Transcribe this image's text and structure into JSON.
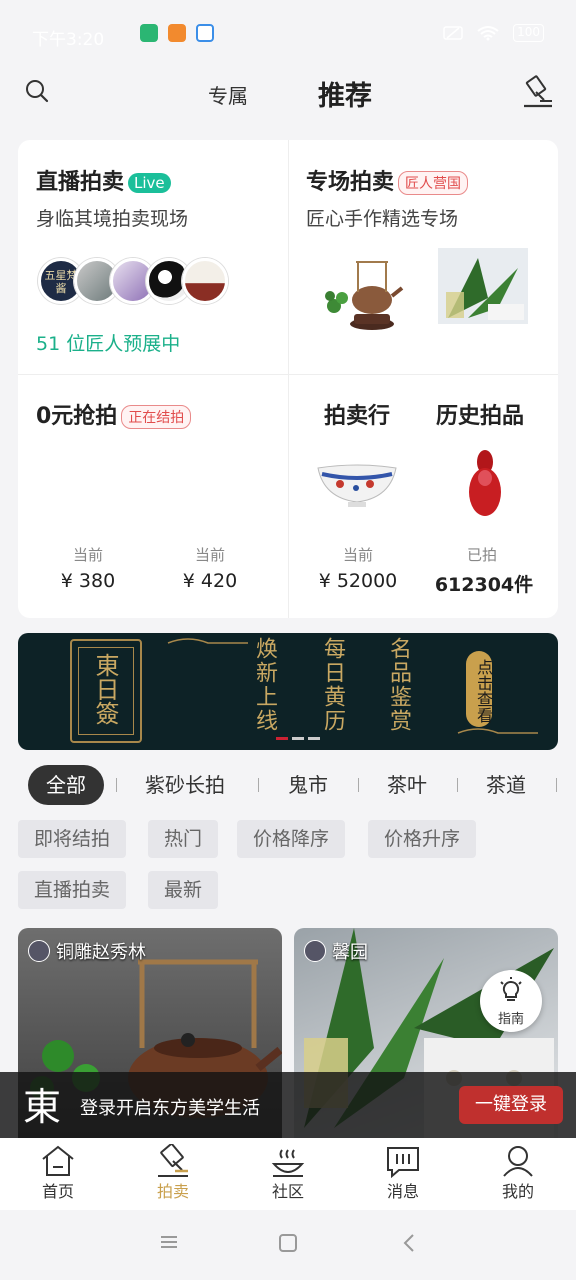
{
  "status": {
    "time": "下午3:20",
    "battery": "100"
  },
  "top": {
    "tab_exclusive": "专属",
    "tab_recommend": "推荐"
  },
  "live": {
    "title": "直播拍卖",
    "badge": "Live",
    "subtitle": "身临其境拍卖现场",
    "preview": "51 位匠人预展中",
    "avatar1_text": "五星梵酱"
  },
  "special": {
    "title": "专场拍卖",
    "badge": "匠人营国",
    "subtitle": "匠心手作精选专场"
  },
  "zero": {
    "title": "0元抢拍",
    "badge": "正在结拍",
    "items": [
      {
        "label": "当前",
        "price": "¥ 380"
      },
      {
        "label": "当前",
        "price": "¥ 420"
      }
    ]
  },
  "auction_house": {
    "title": "拍卖行",
    "label": "当前",
    "price": "¥ 52000"
  },
  "history": {
    "title": "历史拍品",
    "label": "已拍",
    "count": "612304件"
  },
  "banner": {
    "logo": "東日簽",
    "col1": "焕新上线",
    "col2": "每日黄历",
    "col3": "名品鉴赏",
    "cta": "点击查看"
  },
  "categories": [
    "全部",
    "紫砂长拍",
    "鬼市",
    "茶叶",
    "茶道"
  ],
  "filters": [
    "即将结拍",
    "热门",
    "价格降序",
    "价格升序",
    "直播拍卖",
    "最新"
  ],
  "feed": [
    {
      "name": "铜雕赵秀林"
    },
    {
      "name": "馨园"
    }
  ],
  "guide": {
    "label": "指南"
  },
  "login": {
    "logo": "東",
    "text": "登录开启东方美学生活",
    "button": "一键登录"
  },
  "tabbar": [
    {
      "label": "首页"
    },
    {
      "label": "拍卖"
    },
    {
      "label": "社区"
    },
    {
      "label": "消息"
    },
    {
      "label": "我的"
    }
  ],
  "colors": {
    "accent": "#c9a04d",
    "live": "#1bbf9a",
    "red": "#c0302e"
  }
}
